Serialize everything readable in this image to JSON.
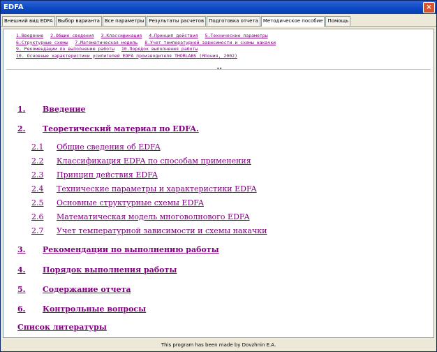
{
  "window": {
    "title": "EDFA",
    "close_label": "×"
  },
  "tabs": [
    {
      "label": "Внешний вид EDFA"
    },
    {
      "label": "Выбор варианта"
    },
    {
      "label": "Все параметры"
    },
    {
      "label": "Результаты расчетов"
    },
    {
      "label": "Подготовка отчета"
    },
    {
      "label": "Методическое пособие"
    },
    {
      "label": "Помощь"
    }
  ],
  "toc_lines": [
    [
      "1.Введение",
      "2.Общие сведения",
      "3.Классификация",
      "4.Принцип действия",
      "5.Технические параметры"
    ],
    [
      "6.Структурные схемы",
      "7.Математическая модель",
      "8.Учет температурной зависимости и схемы накачки"
    ],
    [
      "9. Рекомендации по выполнению работы",
      "10.Порядок выполнения работы"
    ],
    [
      "10. Основные характеристики усилителей EDFA производителя THORLABS (Япония, 2002)"
    ]
  ],
  "divider_dots": "••",
  "sections": [
    {
      "num": "1.",
      "label": "Введение"
    },
    {
      "num": "2.",
      "label": "Теоретический материал по EDFA."
    },
    {
      "num": "3.",
      "label": "Рекомендации по выполнению работы"
    },
    {
      "num": "4.",
      "label": "Порядок выполнения работы"
    },
    {
      "num": "5.",
      "label": "Содержание отчета"
    },
    {
      "num": "6.",
      "label": "Контрольные вопросы"
    },
    {
      "num": "",
      "label": "Список литературы"
    }
  ],
  "subsections": [
    {
      "num": "2.1",
      "label": "Общие сведения об EDFA"
    },
    {
      "num": "2.2",
      "label": "Классификация EDFA по способам применения"
    },
    {
      "num": "2.3",
      "label": "Принцип действия EDFA"
    },
    {
      "num": "2.4",
      "label": "Технические параметры и характеристики EDFA"
    },
    {
      "num": "2.5",
      "label": "Основные структурные схемы EDFA"
    },
    {
      "num": "2.6",
      "label": "Математическая модель многоволнового EDFA"
    },
    {
      "num": "2.7",
      "label": "Учет температурной зависимости и схемы накачки"
    }
  ],
  "status": "This program has been made by Dovzhnin E.A.",
  "colors": {
    "link": "#800080",
    "titlebar": "#0B48C4",
    "frame": "#ECE9D8"
  }
}
